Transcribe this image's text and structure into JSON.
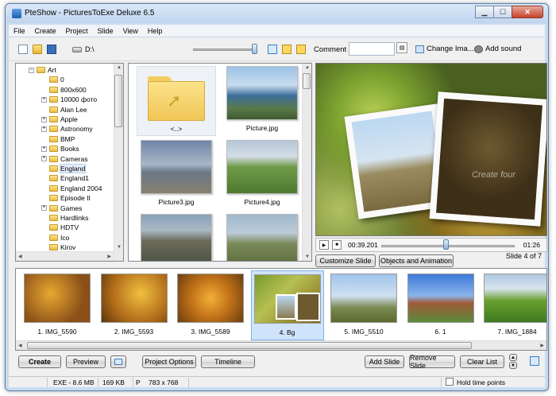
{
  "window": {
    "title": "PteShow - PicturesToExe Deluxe 6.5"
  },
  "menu": [
    "File",
    "Create",
    "Project",
    "Slide",
    "View",
    "Help"
  ],
  "toolbar": {
    "path": "D:\\",
    "comment_label": "Comment",
    "comment_value": "",
    "change_image": "Change Ima...",
    "add_sound": "Add sound"
  },
  "tree": {
    "items": [
      {
        "label": "Art",
        "depth": 0,
        "expander": "−",
        "selected": false
      },
      {
        "label": "0",
        "depth": 1,
        "expander": "",
        "selected": false
      },
      {
        "label": "800x600",
        "depth": 1,
        "expander": "",
        "selected": false
      },
      {
        "label": "10000 фото",
        "depth": 1,
        "expander": "+",
        "selected": false
      },
      {
        "label": "Alan Lee",
        "depth": 1,
        "expander": "",
        "selected": false
      },
      {
        "label": "Apple",
        "depth": 1,
        "expander": "+",
        "selected": false
      },
      {
        "label": "Astronomy",
        "depth": 1,
        "expander": "+",
        "selected": false
      },
      {
        "label": "BMP",
        "depth": 1,
        "expander": "",
        "selected": false
      },
      {
        "label": "Books",
        "depth": 1,
        "expander": "+",
        "selected": false
      },
      {
        "label": "Cameras",
        "depth": 1,
        "expander": "+",
        "selected": false
      },
      {
        "label": "England",
        "depth": 1,
        "expander": "",
        "selected": true
      },
      {
        "label": "England1",
        "depth": 1,
        "expander": "",
        "selected": false
      },
      {
        "label": "England 2004",
        "depth": 1,
        "expander": "",
        "selected": false
      },
      {
        "label": "Episode II",
        "depth": 1,
        "expander": "",
        "selected": false
      },
      {
        "label": "Games",
        "depth": 1,
        "expander": "+",
        "selected": false
      },
      {
        "label": "Hardlinks",
        "depth": 1,
        "expander": "",
        "selected": false
      },
      {
        "label": "HDTV",
        "depth": 1,
        "expander": "",
        "selected": false
      },
      {
        "label": "Ico",
        "depth": 1,
        "expander": "",
        "selected": false
      },
      {
        "label": "Kirov",
        "depth": 1,
        "expander": "",
        "selected": false
      }
    ]
  },
  "files": [
    {
      "name": "<..>",
      "kind": "up"
    },
    {
      "name": "Picture.jpg",
      "kind": "sea"
    },
    {
      "name": "Picture3.jpg",
      "kind": "pier"
    },
    {
      "name": "Picture4.jpg",
      "kind": "field"
    },
    {
      "name": "",
      "kind": "bridge"
    },
    {
      "name": "",
      "kind": "coast"
    }
  ],
  "preview": {
    "watermark": "Create four",
    "time_current": "00:39.201",
    "time_total": "01:26",
    "progress": 0.48
  },
  "buttons": {
    "customize_slide": "Customize Slide",
    "objects_animation": "Objects and Animation",
    "slide_counter": "Slide 4 of 7",
    "create": "Create",
    "preview": "Preview",
    "project_options": "Project Options",
    "timeline": "Timeline",
    "add_slide": "Add Slide",
    "remove_slide": "Remove Slide",
    "clear_list": "Clear List"
  },
  "slides": [
    {
      "label": "1. IMG_5590",
      "kind": "autumn1",
      "selected": false
    },
    {
      "label": "2. IMG_5593",
      "kind": "autumn2",
      "selected": false
    },
    {
      "label": "3. IMG_5589",
      "kind": "autumn3",
      "selected": false
    },
    {
      "label": "4. Bg",
      "kind": "bg",
      "selected": true
    },
    {
      "label": "5. IMG_5510",
      "kind": "park",
      "selected": false
    },
    {
      "label": "6. 1",
      "kind": "campus",
      "selected": false
    },
    {
      "label": "7. IMG_1884",
      "kind": "green",
      "selected": false
    }
  ],
  "status": {
    "format": "EXE - 8.6 MB",
    "size": "169 KB",
    "p": "P",
    "dims": "783 x 768",
    "hold_time": "Hold time points"
  }
}
